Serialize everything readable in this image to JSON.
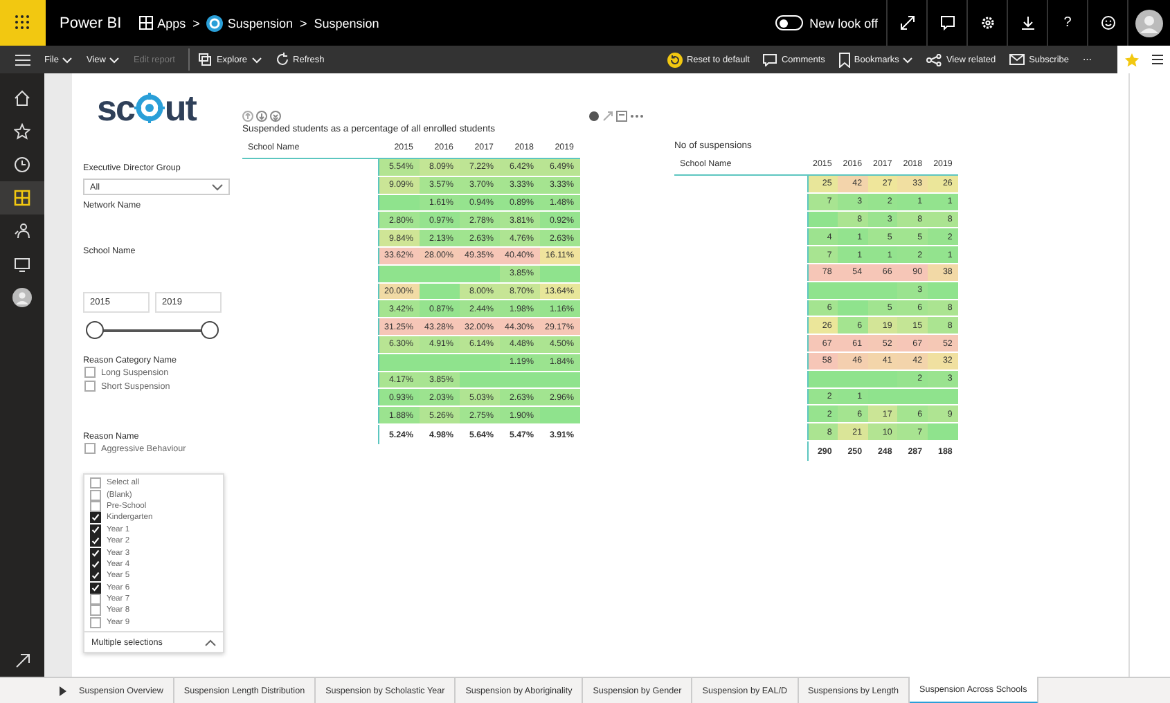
{
  "top_bar": {
    "app_name": "Power BI",
    "breadcrumbs": [
      {
        "label": "Apps",
        "kind": "apps"
      },
      {
        "label": "Suspension",
        "kind": "app"
      },
      {
        "label": "Suspension",
        "kind": "page"
      }
    ],
    "separator": ">",
    "new_look": {
      "label": "New look off",
      "on": false
    },
    "help": "?"
  },
  "toolbar": {
    "left": [
      {
        "label": "File",
        "kind": "menu",
        "disabled": false
      },
      {
        "label": "View",
        "kind": "menu",
        "disabled": false
      },
      {
        "label": "Edit report",
        "kind": "plain",
        "disabled": true
      },
      {
        "label": "Explore",
        "kind": "explore",
        "disabled": false
      },
      {
        "label": "Refresh",
        "kind": "refresh",
        "disabled": false
      }
    ],
    "right": [
      {
        "label": "Reset to default",
        "kind": "reset"
      },
      {
        "label": "Comments",
        "kind": "comment"
      },
      {
        "label": "Bookmarks",
        "kind": "bookmark"
      },
      {
        "label": "View related",
        "kind": "related"
      },
      {
        "label": "Subscribe",
        "kind": "mail"
      }
    ],
    "more": "⋯"
  },
  "nav_rail": [
    {
      "kind": "home",
      "selected": false
    },
    {
      "kind": "star",
      "selected": false
    },
    {
      "kind": "clock",
      "selected": false
    },
    {
      "kind": "apps",
      "selected": true
    },
    {
      "kind": "person",
      "selected": false
    },
    {
      "kind": "monitor",
      "selected": false
    },
    {
      "kind": "avatar",
      "selected": false
    }
  ],
  "logo": {
    "before": "sc",
    "after": "ut"
  },
  "slicers": {
    "executive_director_group": {
      "label": "Executive Director Group",
      "value": "All"
    },
    "network_name": {
      "label": "Network Name"
    },
    "school_name": {
      "label": "School Name"
    },
    "year_range": {
      "from": "2015",
      "to": "2019",
      "start": {
        "level": 0
      },
      "end": {
        "level": 1
      }
    },
    "reason_category": {
      "label": "Reason Category Name",
      "options": [
        {
          "label": "Long Suspension",
          "checked": false
        },
        {
          "label": "Short Suspension",
          "checked": false
        }
      ]
    },
    "reason_name": {
      "label": "Reason Name",
      "options": [
        {
          "label": "Aggressive Behaviour",
          "checked": false
        }
      ]
    },
    "year_dropdown": {
      "items": [
        {
          "label": "Select all",
          "checked": false
        },
        {
          "label": "(Blank)",
          "checked": false
        },
        {
          "label": "Pre-School",
          "checked": false
        },
        {
          "label": "Kindergarten",
          "checked": true
        },
        {
          "label": "Year 1",
          "checked": true
        },
        {
          "label": "Year 2",
          "checked": true
        },
        {
          "label": "Year 3",
          "checked": true
        },
        {
          "label": "Year 4",
          "checked": true
        },
        {
          "label": "Year 5",
          "checked": true
        },
        {
          "label": "Year 6",
          "checked": true
        },
        {
          "label": "Year 7",
          "checked": false
        },
        {
          "label": "Year 8",
          "checked": false
        },
        {
          "label": "Year 9",
          "checked": false
        }
      ],
      "value": "Multiple selections",
      "expanded": true
    }
  },
  "tables": [
    {
      "title": "Suspended students as a percentage of all enrolled students",
      "columns": [
        "School Name",
        "2015",
        "2016",
        "2017",
        "2018",
        "2019"
      ],
      "rows": [
        [
          "",
          "5.54%",
          "8.09%",
          "7.22%",
          "6.42%",
          "6.49%"
        ],
        [
          "",
          "9.09%",
          "3.57%",
          "3.70%",
          "3.33%",
          "3.33%"
        ],
        [
          "",
          null,
          "1.61%",
          "0.94%",
          "0.89%",
          "1.48%"
        ],
        [
          "",
          "2.80%",
          "0.97%",
          "2.78%",
          "3.81%",
          "0.92%"
        ],
        [
          "",
          "9.84%",
          "2.13%",
          "2.63%",
          "4.76%",
          "2.63%"
        ],
        [
          "",
          "33.62%",
          "28.00%",
          "49.35%",
          "40.40%",
          "16.11%"
        ],
        [
          "",
          null,
          null,
          null,
          "3.85%",
          null
        ],
        [
          "",
          "20.00%",
          null,
          "8.00%",
          "8.70%",
          "13.64%"
        ],
        [
          "",
          "3.42%",
          "0.87%",
          "2.44%",
          "1.98%",
          "1.16%"
        ],
        [
          "",
          "31.25%",
          "43.28%",
          "32.00%",
          "44.30%",
          "29.17%"
        ],
        [
          "",
          "6.30%",
          "4.91%",
          "6.14%",
          "4.48%",
          "4.50%"
        ],
        [
          "",
          null,
          null,
          null,
          "1.19%",
          "1.84%"
        ],
        [
          "",
          "4.17%",
          "3.85%",
          null,
          null,
          null
        ],
        [
          "",
          "0.93%",
          "2.03%",
          "5.03%",
          "2.63%",
          "2.96%"
        ],
        [
          "",
          "1.88%",
          "5.26%",
          "2.75%",
          "1.90%",
          null
        ]
      ],
      "total": [
        "5.24%",
        "4.98%",
        "5.64%",
        "5.47%",
        "3.91%"
      ]
    },
    {
      "title": "No of suspensions",
      "columns": [
        "School Name",
        "2015",
        "2016",
        "2017",
        "2018",
        "2019"
      ],
      "rows": [
        [
          "",
          "25",
          "42",
          "27",
          "33",
          "26"
        ],
        [
          "",
          "7",
          "3",
          "2",
          "1",
          "1"
        ],
        [
          "",
          null,
          "8",
          "3",
          "8",
          "8"
        ],
        [
          "",
          "4",
          "1",
          "5",
          "5",
          "2"
        ],
        [
          "",
          "7",
          "1",
          "1",
          "2",
          "1"
        ],
        [
          "",
          "78",
          "54",
          "66",
          "90",
          "38"
        ],
        [
          "",
          null,
          null,
          null,
          "3",
          null
        ],
        [
          "",
          "6",
          null,
          "5",
          "6",
          "8"
        ],
        [
          "",
          "26",
          "6",
          "19",
          "15",
          "8"
        ],
        [
          "",
          "67",
          "61",
          "52",
          "67",
          "52"
        ],
        [
          "",
          "58",
          "46",
          "41",
          "42",
          "32"
        ],
        [
          "",
          null,
          null,
          null,
          "2",
          "3"
        ],
        [
          "",
          "2",
          "1",
          null,
          null,
          null
        ],
        [
          "",
          "2",
          "6",
          "17",
          "6",
          "9"
        ],
        [
          "",
          "8",
          "21",
          "10",
          "7",
          null
        ]
      ],
      "total": [
        "290",
        "250",
        "248",
        "287",
        "188"
      ]
    }
  ],
  "page_tabs": [
    {
      "label": "Suspension Overview",
      "selected": false
    },
    {
      "label": "Suspension Length Distribution",
      "selected": false
    },
    {
      "label": "Suspension by Scholastic Year",
      "selected": false
    },
    {
      "label": "Suspension by Aboriginality",
      "selected": false
    },
    {
      "label": "Suspension by Gender",
      "selected": false
    },
    {
      "label": "Suspension by EAL/D",
      "selected": false
    },
    {
      "label": "Suspensions by Length",
      "selected": false
    },
    {
      "label": "Suspension Across Schools",
      "selected": true
    }
  ]
}
